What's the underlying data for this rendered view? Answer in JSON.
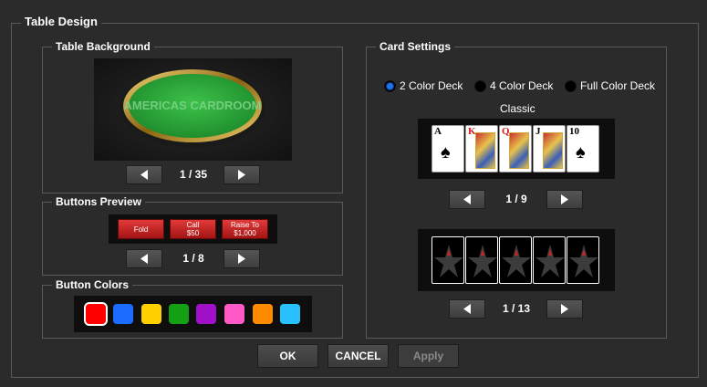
{
  "dialog": {
    "title": "Table Design"
  },
  "table_background": {
    "title": "Table Background",
    "page": "1 / 35",
    "logo_text": "AMERICAS CARDROOM"
  },
  "buttons_preview": {
    "title": "Buttons Preview",
    "page": "1 / 8",
    "buttons": [
      {
        "line1": "Fold",
        "line2": ""
      },
      {
        "line1": "Call",
        "line2": "$50"
      },
      {
        "line1": "Raise To",
        "line2": "$1,000"
      }
    ]
  },
  "button_colors": {
    "title": "Button Colors",
    "swatches": [
      "#ff0000",
      "#1a6cff",
      "#ffd000",
      "#14a014",
      "#a010c8",
      "#ff5ac8",
      "#ff8a00",
      "#28c0ff"
    ],
    "selected_index": 0
  },
  "card_settings": {
    "title": "Card Settings",
    "deck_options": [
      {
        "label": "2 Color Deck",
        "selected": true
      },
      {
        "label": "4 Color Deck",
        "selected": false
      },
      {
        "label": "Full Color Deck",
        "selected": false
      }
    ],
    "front_style_name": "Classic",
    "front_page": "1 / 9",
    "back_page": "1 / 13",
    "cards": [
      {
        "rank": "A",
        "suit": "♠",
        "color": "black",
        "face": false
      },
      {
        "rank": "K",
        "suit": "♥",
        "color": "red",
        "face": true
      },
      {
        "rank": "Q",
        "suit": "♦",
        "color": "red",
        "face": true
      },
      {
        "rank": "J",
        "suit": "♣",
        "color": "black",
        "face": true
      },
      {
        "rank": "10",
        "suit": "♠",
        "color": "black",
        "face": false
      }
    ]
  },
  "footer": {
    "ok": "OK",
    "cancel": "CANCEL",
    "apply": "Apply"
  }
}
